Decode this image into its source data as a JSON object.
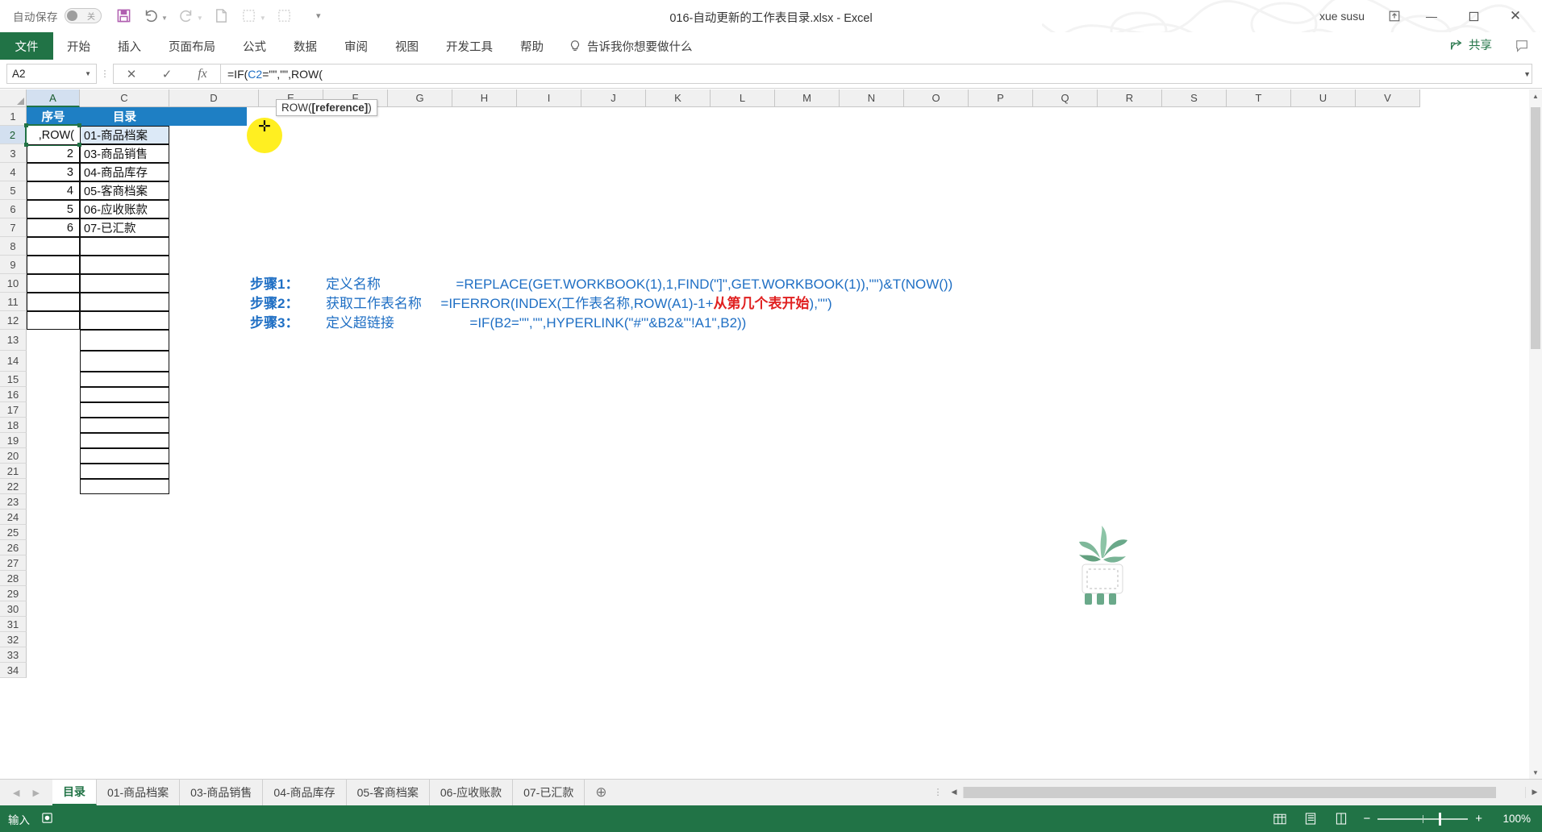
{
  "titlebar": {
    "autosave_label": "自动保存",
    "autosave_state": "关",
    "document_title": "016-自动更新的工作表目录.xlsx  -  Excel",
    "user_name": "xue susu",
    "quick_access": [
      {
        "name": "save-icon",
        "label": "保存"
      },
      {
        "name": "undo-icon",
        "label": "撤消"
      },
      {
        "name": "redo-icon",
        "label": "恢复"
      },
      {
        "name": "print-preview-icon",
        "label": "打印预览和打印"
      },
      {
        "name": "sort-asc-icon",
        "label": "升序排序"
      },
      {
        "name": "sort-desc-icon",
        "label": "降序排序"
      },
      {
        "name": "customize-qat-icon",
        "label": "自定义快速访问工具栏"
      }
    ],
    "window_buttons": [
      "ribbon-display-options",
      "minimize",
      "restore",
      "close"
    ]
  },
  "ribbon": {
    "file_tab": "文件",
    "tabs": [
      "开始",
      "插入",
      "页面布局",
      "公式",
      "数据",
      "审阅",
      "视图",
      "开发工具",
      "帮助"
    ],
    "tellme": "告诉我你想要做什么",
    "share_label": "共享",
    "comment_label": "批注"
  },
  "formula_bar": {
    "name_box": "A2",
    "cancel_label": "取消",
    "enter_label": "输入",
    "fx_label": "插入函数",
    "formula_prefix": "=IF(",
    "formula_ref": "C2",
    "formula_suffix": "=\"\",\"\",ROW("
  },
  "grid": {
    "columns": [
      "A",
      "C",
      "D",
      "E",
      "F",
      "G",
      "H",
      "I",
      "J",
      "K",
      "L",
      "M",
      "N",
      "O",
      "P",
      "Q",
      "R",
      "S",
      "T",
      "U",
      "V"
    ],
    "selected_column": "A",
    "rows": [
      1,
      2,
      3,
      4,
      5,
      6,
      7,
      8,
      9,
      10,
      11,
      12,
      13,
      14,
      15,
      16,
      17,
      18,
      19,
      20,
      21,
      22,
      23,
      24,
      25,
      26,
      27,
      28,
      29,
      30,
      31,
      32,
      33,
      34
    ],
    "selected_row": 2,
    "headers": {
      "a1": "序号",
      "c1": "目录"
    },
    "data": [
      {
        "row": 2,
        "a": ",ROW(",
        "c": "01-商品档案"
      },
      {
        "row": 3,
        "a": "2",
        "c": "03-商品销售"
      },
      {
        "row": 4,
        "a": "3",
        "c": "04-商品库存"
      },
      {
        "row": 5,
        "a": "4",
        "c": "05-客商档案"
      },
      {
        "row": 6,
        "a": "5",
        "c": "06-应收账款"
      },
      {
        "row": 7,
        "a": "6",
        "c": "07-已汇款"
      }
    ],
    "tooltip": {
      "prefix": "ROW(",
      "bold": "[reference]",
      "suffix": ")"
    },
    "cursor_glyph": "✛"
  },
  "steps": [
    {
      "label": "步骤1：",
      "desc": "定义名称",
      "formula": "=REPLACE(GET.WORKBOOK(1),1,FIND(\"]\",GET.WORKBOOK(1)),\"\")&T(NOW())",
      "highlight": ""
    },
    {
      "label": "步骤2：",
      "desc": "获取工作表名称",
      "formula_a": "=IFERROR(INDEX(工作表名称,ROW(A1)-1+",
      "highlight": "从第几个表开始",
      "formula_b": "),\"\")"
    },
    {
      "label": "步骤3：",
      "desc": "定义超链接",
      "formula": "=IF(B2=\"\",\"\",HYPERLINK(\"#'\"&B2&\"'!A1\",B2))",
      "highlight": ""
    }
  ],
  "sheet_tabs": {
    "items": [
      "目录",
      "01-商品档案",
      "03-商品销售",
      "04-商品库存",
      "05-客商档案",
      "06-应收账款",
      "07-已汇款"
    ],
    "active": "目录",
    "add_label": "新工作表"
  },
  "status_bar": {
    "mode": "输入",
    "macro_label": "宏录制",
    "views": [
      "normal-view",
      "page-layout-view",
      "page-break-view"
    ],
    "zoom": "100%",
    "zoom_out_label": "缩小",
    "zoom_in_label": "放大"
  },
  "colors": {
    "excel_green": "#217346",
    "header_blue": "#1e7fc4",
    "formula_blue": "#1f6fc4",
    "highlight_red": "#e02020",
    "cursor_yellow": "#ffef21"
  }
}
